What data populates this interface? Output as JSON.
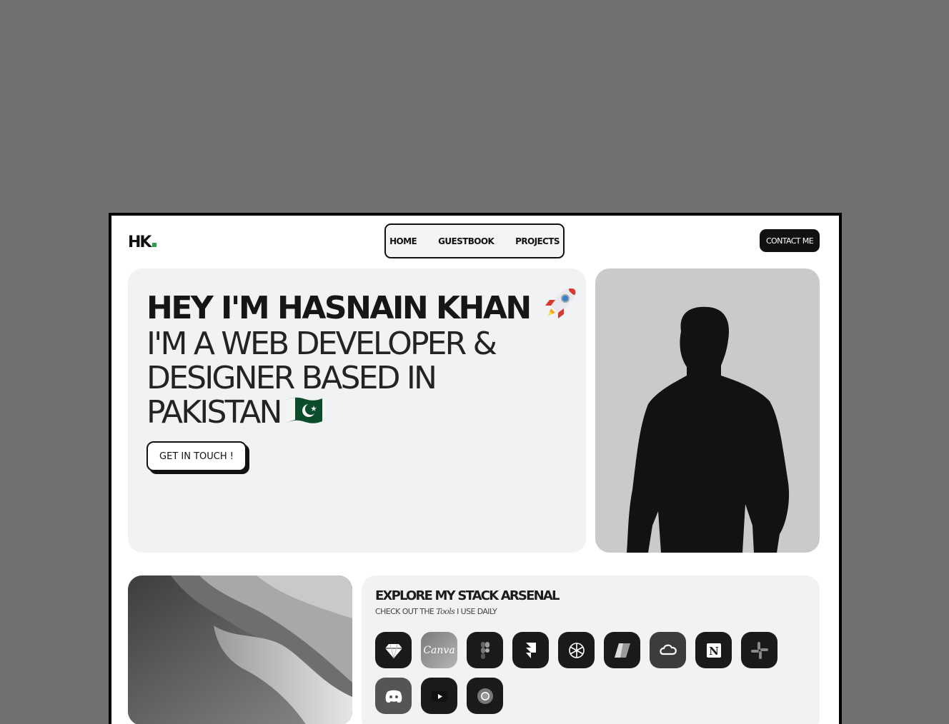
{
  "brand": {
    "logo": "HK",
    "accent": "#2e9e4e"
  },
  "nav": {
    "items": [
      "HOME",
      "GUESTBOOK",
      "PROJECTS"
    ]
  },
  "contact_label": "CONTACT ME",
  "hero": {
    "heading": "HEY I'M HASNAIN KHAN",
    "heading_icon": "rocket-icon",
    "subline": "I'M A WEB DEVELOPER & DESIGNER BASED IN PAKISTAN",
    "subline_icon": "pakistan-flag-icon",
    "cta_label": "GET IN TOUCH !"
  },
  "portrait": {
    "icon": "person-silhouette"
  },
  "stack": {
    "title": "EXPLORE MY STACK ARSENAL",
    "tagline_prefix": "CHECK OUT THE",
    "tagline_emph": "Tools",
    "tagline_suffix": "I USE DAILY",
    "tools": [
      {
        "name": "sketch-icon"
      },
      {
        "name": "canva-icon",
        "label": "Canva"
      },
      {
        "name": "figma-icon"
      },
      {
        "name": "framer-icon"
      },
      {
        "name": "chatgpt-icon"
      },
      {
        "name": "copilot-icon"
      },
      {
        "name": "creative-cloud-icon"
      },
      {
        "name": "notion-icon"
      },
      {
        "name": "slack-icon"
      },
      {
        "name": "discord-icon"
      },
      {
        "name": "youtube-icon"
      },
      {
        "name": "chrome-icon"
      }
    ]
  }
}
